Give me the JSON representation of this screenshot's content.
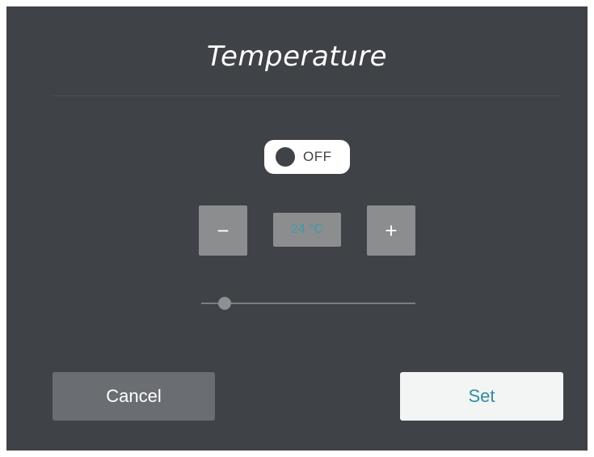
{
  "dialog": {
    "title": "Temperature"
  },
  "power_toggle": {
    "state_label": "OFF",
    "is_on": false
  },
  "stepper": {
    "minus_label": "−",
    "plus_label": "+",
    "value_label": "24 °C"
  },
  "slider": {
    "level_fraction": 0.11
  },
  "actions": {
    "cancel_label": "Cancel",
    "set_label": "Set"
  },
  "colors": {
    "dialog_background": "#3f4246",
    "accent": "#2e8fa0",
    "control_gray": "#8b8d8f"
  }
}
